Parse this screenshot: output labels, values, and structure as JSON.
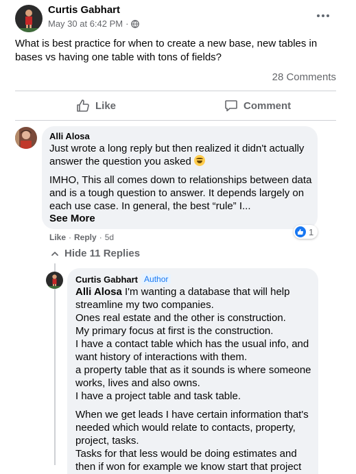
{
  "post": {
    "author": "Curtis Gabhart",
    "timestamp": "May 30 at 6:42 PM",
    "meta_separator": "·",
    "privacy_icon": "globe-icon",
    "menu_icon": "more-dots-icon",
    "text": "What is best practice for when to create a new base, new tables in bases vs having one table with tons of fields?",
    "comments_count": "28 Comments",
    "like_label": "Like",
    "comment_label": "Comment"
  },
  "comments": [
    {
      "author": "Alli Alosa",
      "paragraph1": "Just wrote a long reply but then realized it didn't actually answer the question you asked",
      "emoji": "grinning-sweat-emoji",
      "paragraph2": "IMHO, This all comes down to relationships between data and is a tough question to answer. It depends largely on each use case. In general, the best “rule” I...",
      "see_more": "See More",
      "reaction_count": "1",
      "actions": {
        "like": "Like",
        "reply": "Reply",
        "time": "5d",
        "sep": "·"
      },
      "hide_replies": "Hide 11 Replies"
    }
  ],
  "reply": {
    "author": "Curtis Gabhart",
    "badge": "Author",
    "mention": "Alli Alosa",
    "paragraph1_rest": " I'm wanting a database that will help streamline my two companies.\nOnes real estate and the other is construction.\nMy primary focus at first is the construction.\nI have a contact table which has the usual info, and want history of interactions with them.\na property table that as it sounds is where someone works, lives and also owns.\nI have a project table and task table.",
    "paragraph2": "When we get leads I have certain information that's needed which would relate to contacts, property, project, tasks.\nTasks for that less would be doing estimates and then if won for example we know start that project"
  },
  "colors": {
    "text": "#050505",
    "secondary": "#65676b",
    "bubble": "#f0f2f5",
    "accent": "#1877f2"
  }
}
